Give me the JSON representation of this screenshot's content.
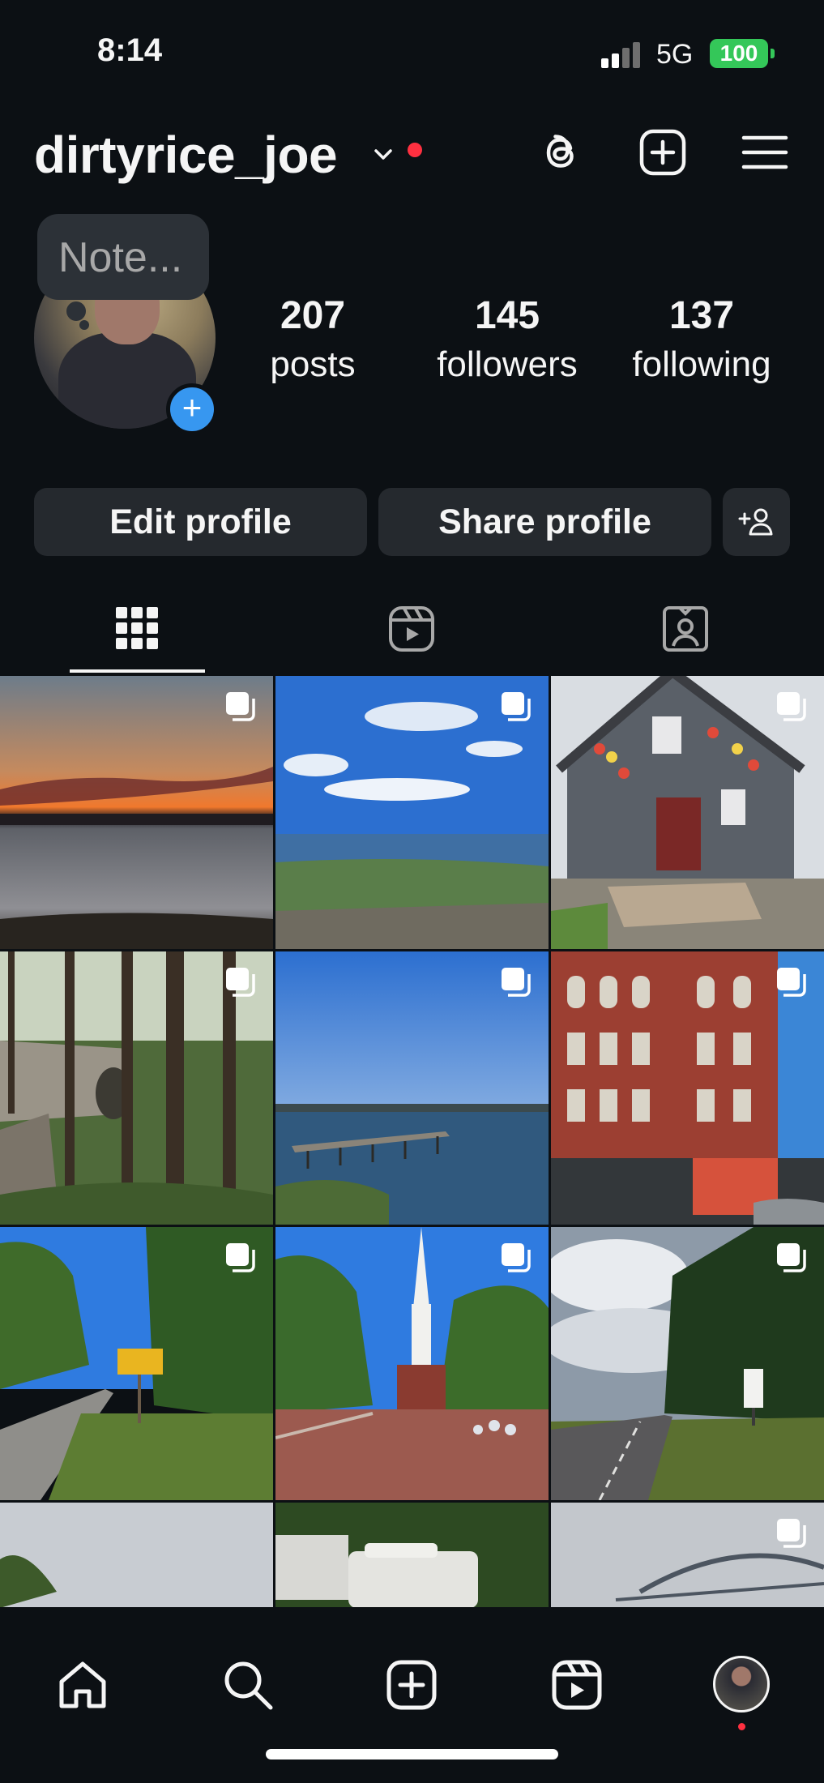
{
  "status": {
    "time": "8:14",
    "network": "5G",
    "battery": "100"
  },
  "header": {
    "username": "dirtyrice_joe",
    "icons": [
      "threads-icon",
      "create-icon",
      "menu-icon"
    ]
  },
  "profile": {
    "note_placeholder": "Note...",
    "stats": [
      {
        "value": "207",
        "label": "posts"
      },
      {
        "value": "145",
        "label": "followers"
      },
      {
        "value": "137",
        "label": "following"
      }
    ]
  },
  "buttons": {
    "edit": "Edit profile",
    "share": "Share profile",
    "discover_icon": "add-person-icon"
  },
  "tabs": [
    {
      "name": "grid",
      "icon": "grid-icon",
      "active": true
    },
    {
      "name": "reels",
      "icon": "reels-icon",
      "active": false
    },
    {
      "name": "tagged",
      "icon": "tagged-icon",
      "active": false
    }
  ],
  "grid_posts": [
    {
      "subject": "sunset-over-lake",
      "multi": true
    },
    {
      "subject": "coastal-overlook",
      "multi": true
    },
    {
      "subject": "buoy-shop",
      "multi": true
    },
    {
      "subject": "forest-stone-bridge",
      "multi": true
    },
    {
      "subject": "harbor-pier",
      "multi": true
    },
    {
      "subject": "brick-building",
      "multi": true
    },
    {
      "subject": "country-road-sign",
      "multi": true
    },
    {
      "subject": "town-church",
      "multi": true
    },
    {
      "subject": "highway-clouds",
      "multi": true
    },
    {
      "subject": "cloudy-trees",
      "multi": false
    },
    {
      "subject": "camper-vans",
      "multi": false
    },
    {
      "subject": "bridge-sky",
      "multi": true
    }
  ],
  "bottom_nav": [
    "home-icon",
    "search-icon",
    "create-icon",
    "reels-icon",
    "profile-avatar"
  ],
  "colors": {
    "background": "#0c1014",
    "button": "#25292e",
    "accent": "#3797f0",
    "notification": "#ff3040",
    "battery": "#34c759"
  }
}
